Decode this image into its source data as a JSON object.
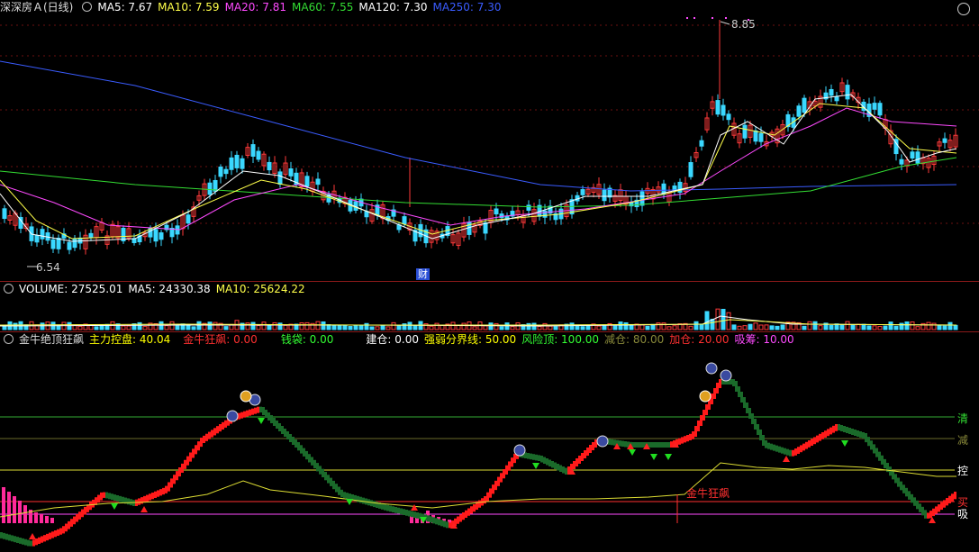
{
  "main": {
    "title": "深深房Ａ(日线)",
    "ma": [
      {
        "label": "MA5: 7.67",
        "color": "#ffffff"
      },
      {
        "label": "MA10: 7.59",
        "color": "#ffff4a"
      },
      {
        "label": "MA20: 7.81",
        "color": "#ff4aff"
      },
      {
        "label": "MA60: 7.55",
        "color": "#33dd33"
      },
      {
        "label": "MA120: 7.30",
        "color": "#ffffff"
      },
      {
        "label": "MA250: 7.30",
        "color": "#3a5cff"
      }
    ],
    "high_label": "8.85",
    "low_label": "6.54",
    "finance_badge": "财"
  },
  "volume": {
    "items": [
      {
        "label": "VOLUME: 27525.01",
        "color": "#ffffff"
      },
      {
        "label": "MA5: 24330.38",
        "color": "#ffffff"
      },
      {
        "label": "MA10: 25624.22",
        "color": "#ffff4a"
      }
    ]
  },
  "indicator": {
    "name": "金牛绝顶狂飙",
    "items": [
      {
        "label": "主力控盘: 40.04",
        "color": "#ffff00"
      },
      {
        "label": "金牛狂飙: 0.00",
        "color": "#ff3030"
      },
      {
        "label": "钱袋: 0.00",
        "color": "#33ff33"
      },
      {
        "label": "建仓: 0.00",
        "color": "#ffffff"
      },
      {
        "label": "强弱分界线: 50.00",
        "color": "#ffff00"
      },
      {
        "label": "风险顶: 100.00",
        "color": "#33ff33"
      },
      {
        "label": "减仓: 80.00",
        "color": "#8a8a3a"
      },
      {
        "label": "加仓: 20.00",
        "color": "#ff3030"
      },
      {
        "label": "吸筹: 10.00",
        "color": "#ff4aff"
      }
    ],
    "levels": [
      "清",
      "减",
      "控",
      "买",
      "吸"
    ],
    "annotation": "金牛狂飙"
  }
}
